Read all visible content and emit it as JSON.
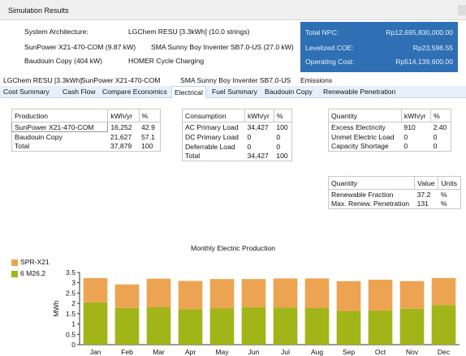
{
  "window": {
    "title": "Simulation Results"
  },
  "system_architecture": {
    "label": "System Architecture:",
    "rows": [
      {
        "left": "",
        "right": "LGChem RESU [3.3kWh] (10.0 strings)"
      },
      {
        "left": "SunPower X21-470-COM (9.87 kW)",
        "right": "SMA Sunny Boy Inventer SB7.0-US (27.0 kW)"
      },
      {
        "left": "Baudouin Copy (404 kW)",
        "right": "HOMER Cycle Charging"
      }
    ]
  },
  "summary": {
    "rows": [
      {
        "label": "Total NPC:",
        "value": "Rp12,695,830,000.00"
      },
      {
        "label": "Levelized COE:",
        "value": "Rp23,596.55"
      },
      {
        "label": "Operating Cost:",
        "value": "Rp514,139,600.00"
      }
    ],
    "bg_color": "#2f6fb3"
  },
  "tabs_top": [
    "LGChem RESU [3.3kWh]",
    "SunPower X21-470-COM",
    "SMA Sunny Boy Inventer SB7.0-US",
    "Emissions"
  ],
  "tabs_bottom": [
    "Cost Summary",
    "Cash Flow",
    "Compare Economics",
    "Electrical",
    "Fuel Summary",
    "Baudouin Copy",
    "Renewable Penetration"
  ],
  "active_tab": "Electrical",
  "production_table": {
    "headers": [
      "Production",
      "kWh/yr",
      "%"
    ],
    "rows": [
      [
        "SunPower X21-470-COM",
        "16,252",
        "42.9"
      ],
      [
        "Baudouin Copy",
        "21,627",
        "57.1"
      ],
      [
        "Total",
        "37,879",
        "100"
      ]
    ]
  },
  "consumption_table": {
    "headers": [
      "Consumption",
      "kWh/yr",
      "%"
    ],
    "rows": [
      [
        "AC Primary Load",
        "34,427",
        "100"
      ],
      [
        "DC Primary Load",
        "0",
        "0"
      ],
      [
        "Deferrable Load",
        "0",
        "0"
      ],
      [
        "Total",
        "34,427",
        "100"
      ]
    ]
  },
  "quantity_table": {
    "headers": [
      "Quantity",
      "kWh/yr",
      "%"
    ],
    "rows": [
      [
        "Excess Electricity",
        "910",
        "2.40"
      ],
      [
        "Unmet Electric Load",
        "0",
        "0"
      ],
      [
        "Capacity Shortage",
        "0",
        "0"
      ]
    ]
  },
  "renewable_table": {
    "headers": [
      "Quantity",
      "Value",
      "Units"
    ],
    "rows": [
      [
        "Renewable Fraction",
        "37.2",
        "%"
      ],
      [
        "Max. Renew. Penetration",
        "131",
        "%"
      ]
    ]
  },
  "chart_data": {
    "type": "bar",
    "stacked": true,
    "title": "Monthly Electric Production",
    "ylabel": "MWh",
    "xlabel": "",
    "ylim": [
      0,
      3.5
    ],
    "yticks": [
      "0",
      "0.5",
      "1",
      "1.5",
      "2",
      "2.5",
      "3",
      "3.5"
    ],
    "grid": false,
    "legend_position": "top-left",
    "categories": [
      "Jan",
      "Feb",
      "Mar",
      "Apr",
      "May",
      "Jun",
      "Jul",
      "Aug",
      "Sep",
      "Oct",
      "Nov",
      "Dec"
    ],
    "series": [
      {
        "name": "6 M26.2",
        "color": "#a1b519",
        "values": [
          2.05,
          1.78,
          1.81,
          1.72,
          1.75,
          1.82,
          1.8,
          1.77,
          1.63,
          1.65,
          1.74,
          1.92
        ]
      },
      {
        "name": "SPR-X21",
        "color": "#eda452",
        "values": [
          1.18,
          1.14,
          1.39,
          1.37,
          1.43,
          1.36,
          1.41,
          1.44,
          1.45,
          1.5,
          1.34,
          1.31
        ]
      }
    ]
  }
}
